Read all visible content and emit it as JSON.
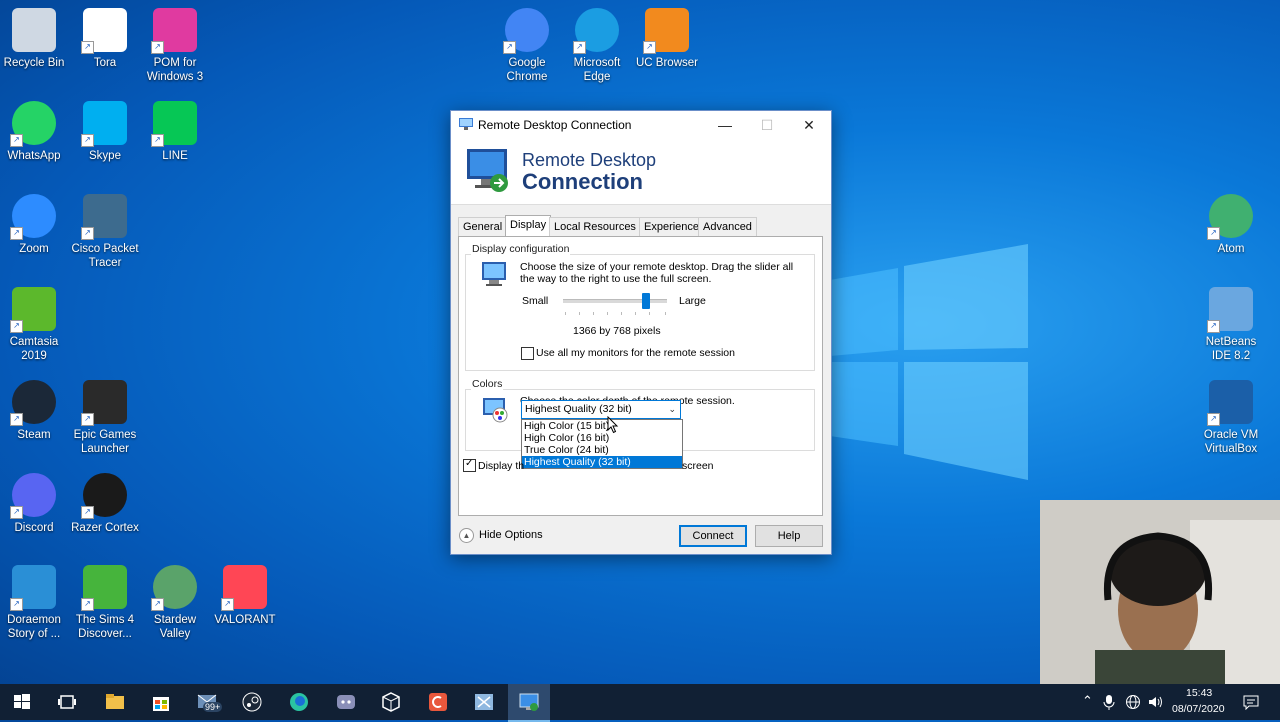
{
  "desktop": {
    "icons": [
      {
        "label": "Recycle Bin",
        "icon": "recycle-bin-icon"
      },
      {
        "label": "Tora",
        "icon": "file-icon"
      },
      {
        "label": "POM for Windows 3",
        "icon": "pom-icon"
      },
      {
        "label": "Google Chrome",
        "icon": "chrome-icon"
      },
      {
        "label": "Microsoft Edge",
        "icon": "edge-icon"
      },
      {
        "label": "UC Browser",
        "icon": "uc-browser-icon"
      },
      {
        "label": "WhatsApp",
        "icon": "whatsapp-icon"
      },
      {
        "label": "Skype",
        "icon": "skype-icon"
      },
      {
        "label": "LINE",
        "icon": "line-icon"
      },
      {
        "label": "Zoom",
        "icon": "zoom-icon"
      },
      {
        "label": "Cisco Packet Tracer",
        "icon": "cisco-packet-tracer-icon"
      },
      {
        "label": "Camtasia 2019",
        "icon": "camtasia-icon"
      },
      {
        "label": "Steam",
        "icon": "steam-icon"
      },
      {
        "label": "Epic Games Launcher",
        "icon": "epic-games-icon"
      },
      {
        "label": "Discord",
        "icon": "discord-icon"
      },
      {
        "label": "Razer Cortex",
        "icon": "razer-cortex-icon"
      },
      {
        "label": "Doraemon Story of ...",
        "icon": "doraemon-icon"
      },
      {
        "label": "The Sims 4 Discover...",
        "icon": "sims4-icon"
      },
      {
        "label": "Stardew Valley",
        "icon": "stardew-icon"
      },
      {
        "label": "VALORANT",
        "icon": "valorant-icon"
      },
      {
        "label": "Atom",
        "icon": "atom-icon"
      },
      {
        "label": "NetBeans IDE 8.2",
        "icon": "netbeans-icon"
      },
      {
        "label": "Oracle VM VirtualBox",
        "icon": "virtualbox-icon"
      }
    ]
  },
  "window": {
    "title": "Remote Desktop Connection",
    "banner_line1": "Remote Desktop",
    "banner_line2": "Connection",
    "tabs": [
      "General",
      "Display",
      "Local Resources",
      "Experience",
      "Advanced"
    ],
    "active_tab": "Display",
    "display_config": {
      "label": "Display configuration",
      "description": "Choose the size of your remote desktop. Drag the slider all the way to the right to use the full screen.",
      "slider_min_label": "Small",
      "slider_max_label": "Large",
      "resolution": "1366 by 768 pixels",
      "all_monitors_label": "Use all my monitors for the remote session",
      "all_monitors_checked": false
    },
    "colors": {
      "label": "Colors",
      "description": "Choose the color depth of the remote session.",
      "selected": "Highest Quality (32 bit)",
      "options": [
        "High Color (15 bit)",
        "High Color (16 bit)",
        "True Color (24 bit)",
        "Highest Quality (32 bit)"
      ]
    },
    "connection_bar": {
      "label_start": "Display th",
      "label_end": "screen",
      "checked": true
    },
    "hide_options": "Hide Options",
    "connect": "Connect",
    "help": "Help"
  },
  "tray": {
    "time": "15:43",
    "date": "08/07/2020",
    "badge": "99+"
  }
}
